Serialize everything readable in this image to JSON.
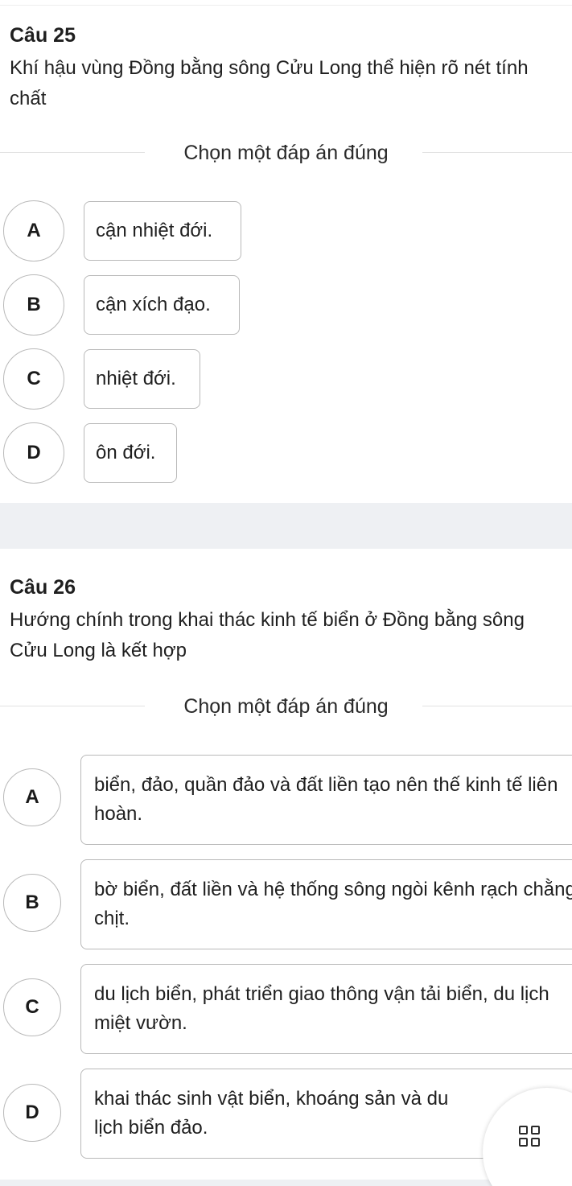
{
  "questions": [
    {
      "title": "Câu 25",
      "text": "Khí hậu vùng Đồng bằng sông Cửu Long thể hiện rõ nét tính chất",
      "instruction": "Chọn một đáp án đúng",
      "options": [
        {
          "letter": "A",
          "text": "cận nhiệt đới."
        },
        {
          "letter": "B",
          "text": "cận xích đạo."
        },
        {
          "letter": "C",
          "text": "nhiệt đới."
        },
        {
          "letter": "D",
          "text": "ôn đới."
        }
      ]
    },
    {
      "title": "Câu 26",
      "text": "Hướng chính trong khai thác kinh tế biển ở Đồng bằng sông Cửu Long là kết hợp",
      "instruction": "Chọn một đáp án đúng",
      "options": [
        {
          "letter": "A",
          "text": "biển, đảo, quần đảo và đất liền tạo nên thế kinh tế liên hoàn."
        },
        {
          "letter": "B",
          "text": "bờ biển, đất liền và hệ thống sông ngòi kênh rạch chằng chịt."
        },
        {
          "letter": "C",
          "text": "du lịch biển, phát triển giao thông vận tải biển, du lịch miệt vườn."
        },
        {
          "letter": "D",
          "text": "khai thác sinh vật biển, khoáng sản và du lịch biển đảo."
        }
      ]
    }
  ],
  "fab_icon": "grid-icon"
}
